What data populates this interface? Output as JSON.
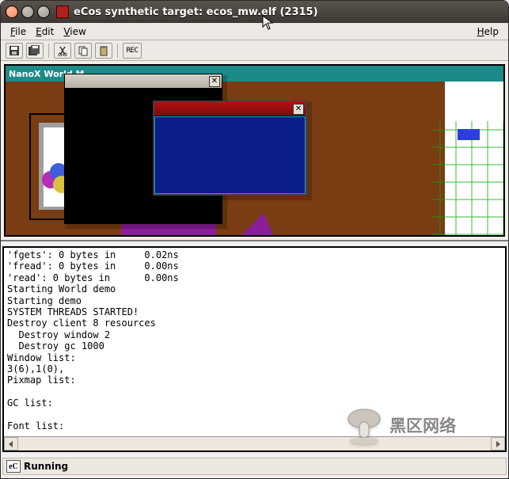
{
  "window": {
    "title": "eCos synthetic target: ecos_mw.elf (2315)"
  },
  "menu": {
    "file": "File",
    "edit": "Edit",
    "view": "View",
    "help": "Help"
  },
  "toolbar": {
    "save1_tip": "save-icon",
    "save2_tip": "save-all-icon",
    "cut_tip": "cut-icon",
    "copy_tip": "copy-icon",
    "paste_tip": "paste-icon",
    "rec_label": "REC"
  },
  "workspace": {
    "map_title": "NanoX World M"
  },
  "log_text": "'fgets': 0 bytes in     0.02ns\n'fread': 0 bytes in     0.00ns\n'read': 0 bytes in      0.00ns\nStarting World demo\nStarting demo\nSYSTEM THREADS STARTED!\nDestroy client 8 resources\n  Destroy window 2\n  Destroy gc 1000\nWindow list:\n3(6),1(0),\nPixmap list:\n\nGC list:\n\nFont list:\n",
  "status": {
    "ec": "eC",
    "text": "Running"
  },
  "watermark_text": "黑区网络"
}
